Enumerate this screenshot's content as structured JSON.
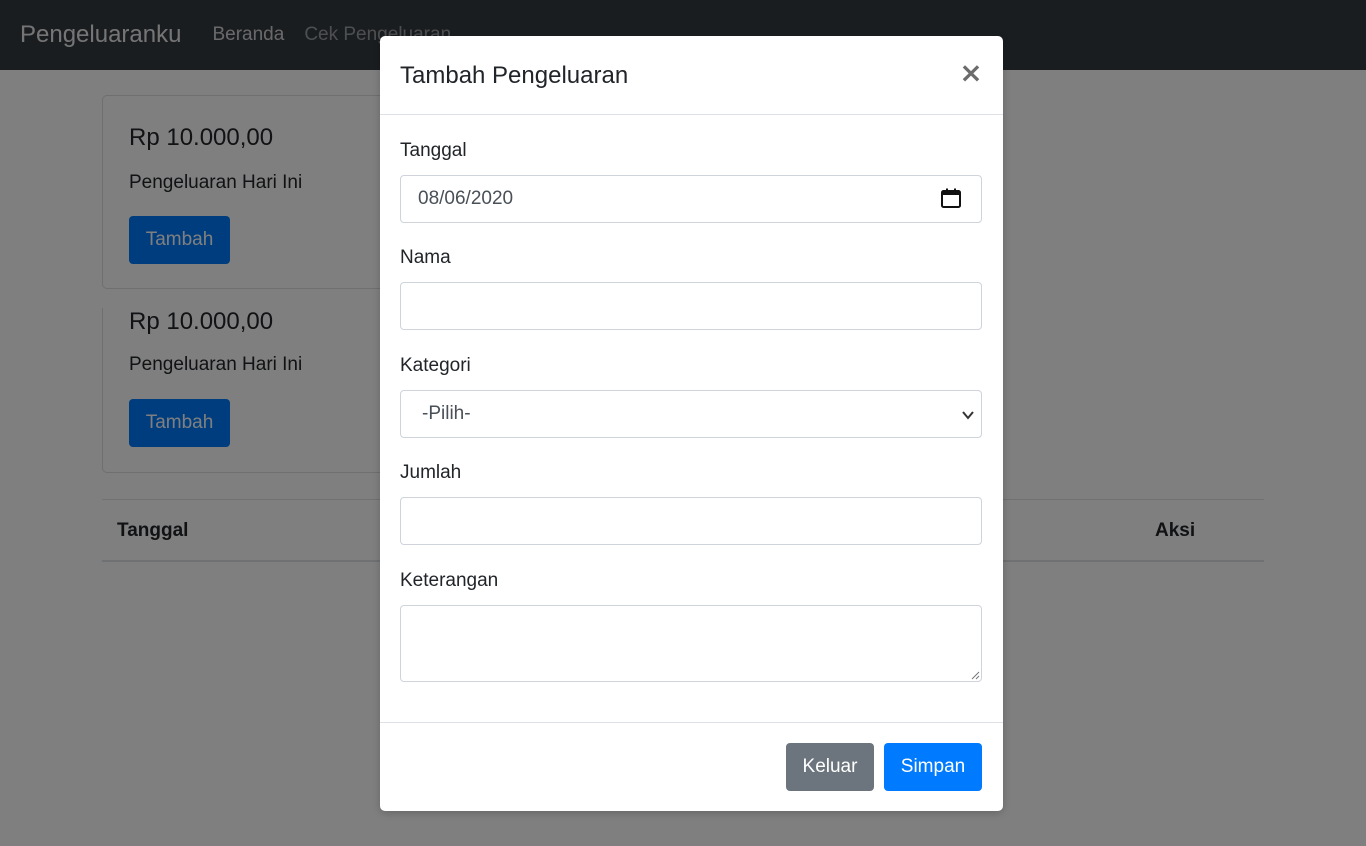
{
  "navbar": {
    "brand": "Pengeluaranku",
    "links": [
      "Beranda",
      "Cek Pengeluaran"
    ]
  },
  "cards": [
    {
      "amount": "Rp 10.000,00",
      "text": "Pengeluaran Hari Ini",
      "button": "Tambah"
    },
    {
      "amount": "Rp 10.000,00",
      "text": "Pengeluaran Hari Ini",
      "button": "Tambah"
    }
  ],
  "table": {
    "headers": [
      "Tanggal",
      "Aksi"
    ]
  },
  "modal": {
    "title": "Tambah Pengeluaran",
    "close_symbol": "×",
    "fields": {
      "tanggal": {
        "label": "Tanggal",
        "value": "08/06/2020"
      },
      "nama": {
        "label": "Nama",
        "value": ""
      },
      "kategori": {
        "label": "Kategori",
        "selected": "-Pilih-"
      },
      "jumlah": {
        "label": "Jumlah",
        "value": ""
      },
      "keterangan": {
        "label": "Keterangan",
        "value": ""
      }
    },
    "buttons": {
      "keluar": "Keluar",
      "simpan": "Simpan"
    }
  },
  "colors": {
    "navbar": "#343a40",
    "primary": "#007bff",
    "secondary": "#6c757d"
  },
  "icons": {
    "close": "close-icon",
    "date": "calendar-icon",
    "select": "chevron-down-icon",
    "textarea": "resize-handle-icon"
  }
}
